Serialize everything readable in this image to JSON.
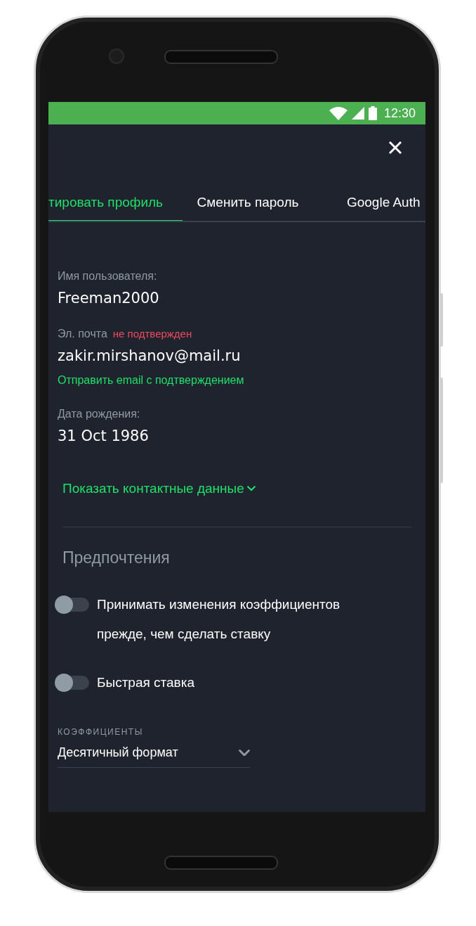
{
  "status_bar": {
    "time": "12:30"
  },
  "tabs": [
    {
      "label": "тировать профиль",
      "selected": true
    },
    {
      "label": "Сменить пароль",
      "selected": false
    },
    {
      "label": "Google Auth",
      "selected": false
    }
  ],
  "profile": {
    "fields": [
      {
        "label": "Имя пользователя:",
        "value": "Freeman2000"
      },
      {
        "label": "Эл. почта",
        "badge": "не подтвержден",
        "value": "zakir.mirshanov@mail.ru",
        "action": "Отправить email с подтверждением"
      },
      {
        "label": "Дата рождения:",
        "value": "31 Oct 1986"
      }
    ],
    "contacts_link": "Показать контактные данные"
  },
  "preferences": {
    "title": "Предпочтения",
    "toggles": [
      {
        "label": "Принимать изменения коэффициентов прежде, чем сделать ставку",
        "on": false
      },
      {
        "label": "Быстрая ставка",
        "on": false
      }
    ],
    "odds": {
      "label": "КОЭФФИЦИЕНТЫ",
      "value": "Десятичный формат"
    }
  }
}
